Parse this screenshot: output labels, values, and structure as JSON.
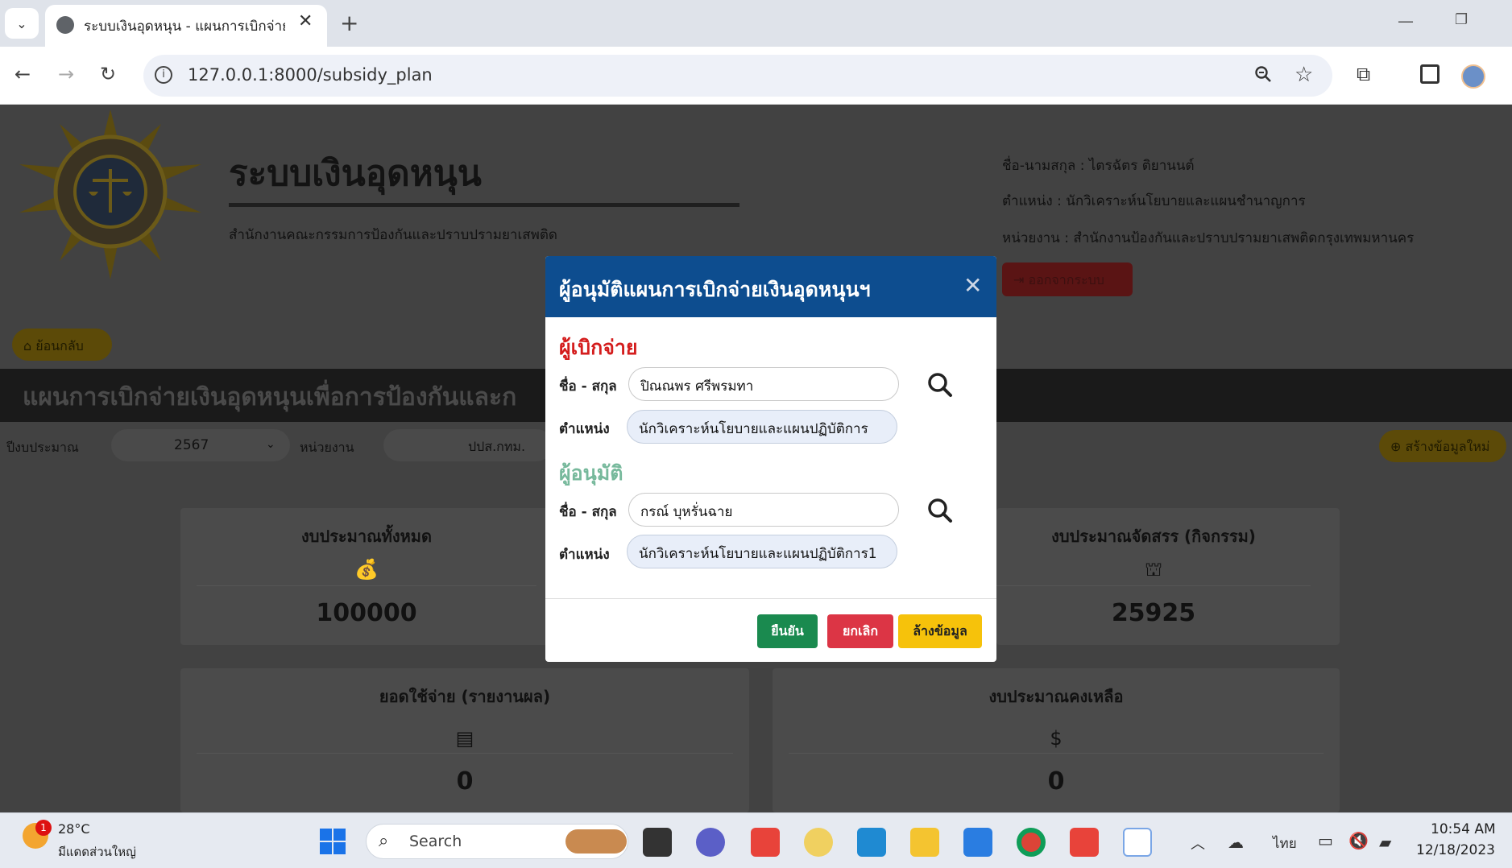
{
  "browser": {
    "tab_title": "ระบบเงินอุดหนุน - แผนการเบิกจ่ายเงิ",
    "url": "127.0.0.1:8000/subsidy_plan"
  },
  "header": {
    "app_title": "ระบบเงินอุดหนุน",
    "agency": "สำนักงานคณะกรรมการป้องกันและปราบปรามยาเสพติด",
    "user_name": "ชื่อ-นามสกุล : ไตรฉัตร ติยานนต์",
    "user_position": "ตำแหน่ง : นักวิเคราะห์นโยบายและแผนชำนาญการ",
    "user_unit": "หน่วยงาน : สำนักงานป้องกันและปราบปรามยาเสพติดกรุงเทพมหานคร",
    "logout_label": "ออกจากระบบ"
  },
  "page": {
    "back_label": "ย้อนกลับ",
    "banner_title": "แผนการเบิกจ่ายเงินอุดหนุนเพื่อการป้องกันและก",
    "year_label": "ปีงบประมาณ",
    "year_value": "2567",
    "unit_label": "หน่วยงาน",
    "unit_value": "ปปส.กทม.",
    "create_label": "สร้างข้อมูลใหม่",
    "cards": {
      "total_budget": {
        "title": "งบประมาณทั้งหมด",
        "value": "100000"
      },
      "allocated_budget": {
        "title": "งบประมาณจัดสรร (กิจกรรม)",
        "value": "25925"
      },
      "expense": {
        "title": "ยอดใช้จ่าย (รายงานผล)",
        "value": "0"
      },
      "remaining": {
        "title": "งบประมาณคงเหลือ",
        "value": "0"
      }
    }
  },
  "modal": {
    "title": "ผู้อนุมัติแผนการเบิกจ่ายเงินอุดหนุนฯ",
    "payer_heading": "ผู้เบิกจ่าย",
    "approver_heading": "ผู้อนุมัติ",
    "name_label": "ชื่อ - สกุล",
    "position_label": "ตำแหน่ง",
    "payer_name": "ปิณณพร ศรีพรมทา",
    "payer_position": "นักวิเคราะห์นโยบายและแผนปฏิบัติการ",
    "approver_name": "กรณ์ บุหรั่นฉาย",
    "approver_position": "นักวิเคราะห์นโยบายและแผนปฏิบัติการ1",
    "confirm_label": "ยืนยัน",
    "cancel_label": "ยกเลิก",
    "clear_label": "ล้างข้อมูล"
  },
  "taskbar": {
    "weather_badge": "1",
    "temperature": "28°C",
    "weather_desc": "มีแดดส่วนใหญ่",
    "search_placeholder": "Search",
    "language": "ไทย",
    "time": "10:54 AM",
    "date": "12/18/2023"
  },
  "colors": {
    "modal_header": "#0d4d8f",
    "payer_heading": "#d41d1d",
    "approver_heading": "#77b99c",
    "confirm": "#1a8a4f",
    "cancel": "#dc3545",
    "clear": "#f6c20b"
  }
}
